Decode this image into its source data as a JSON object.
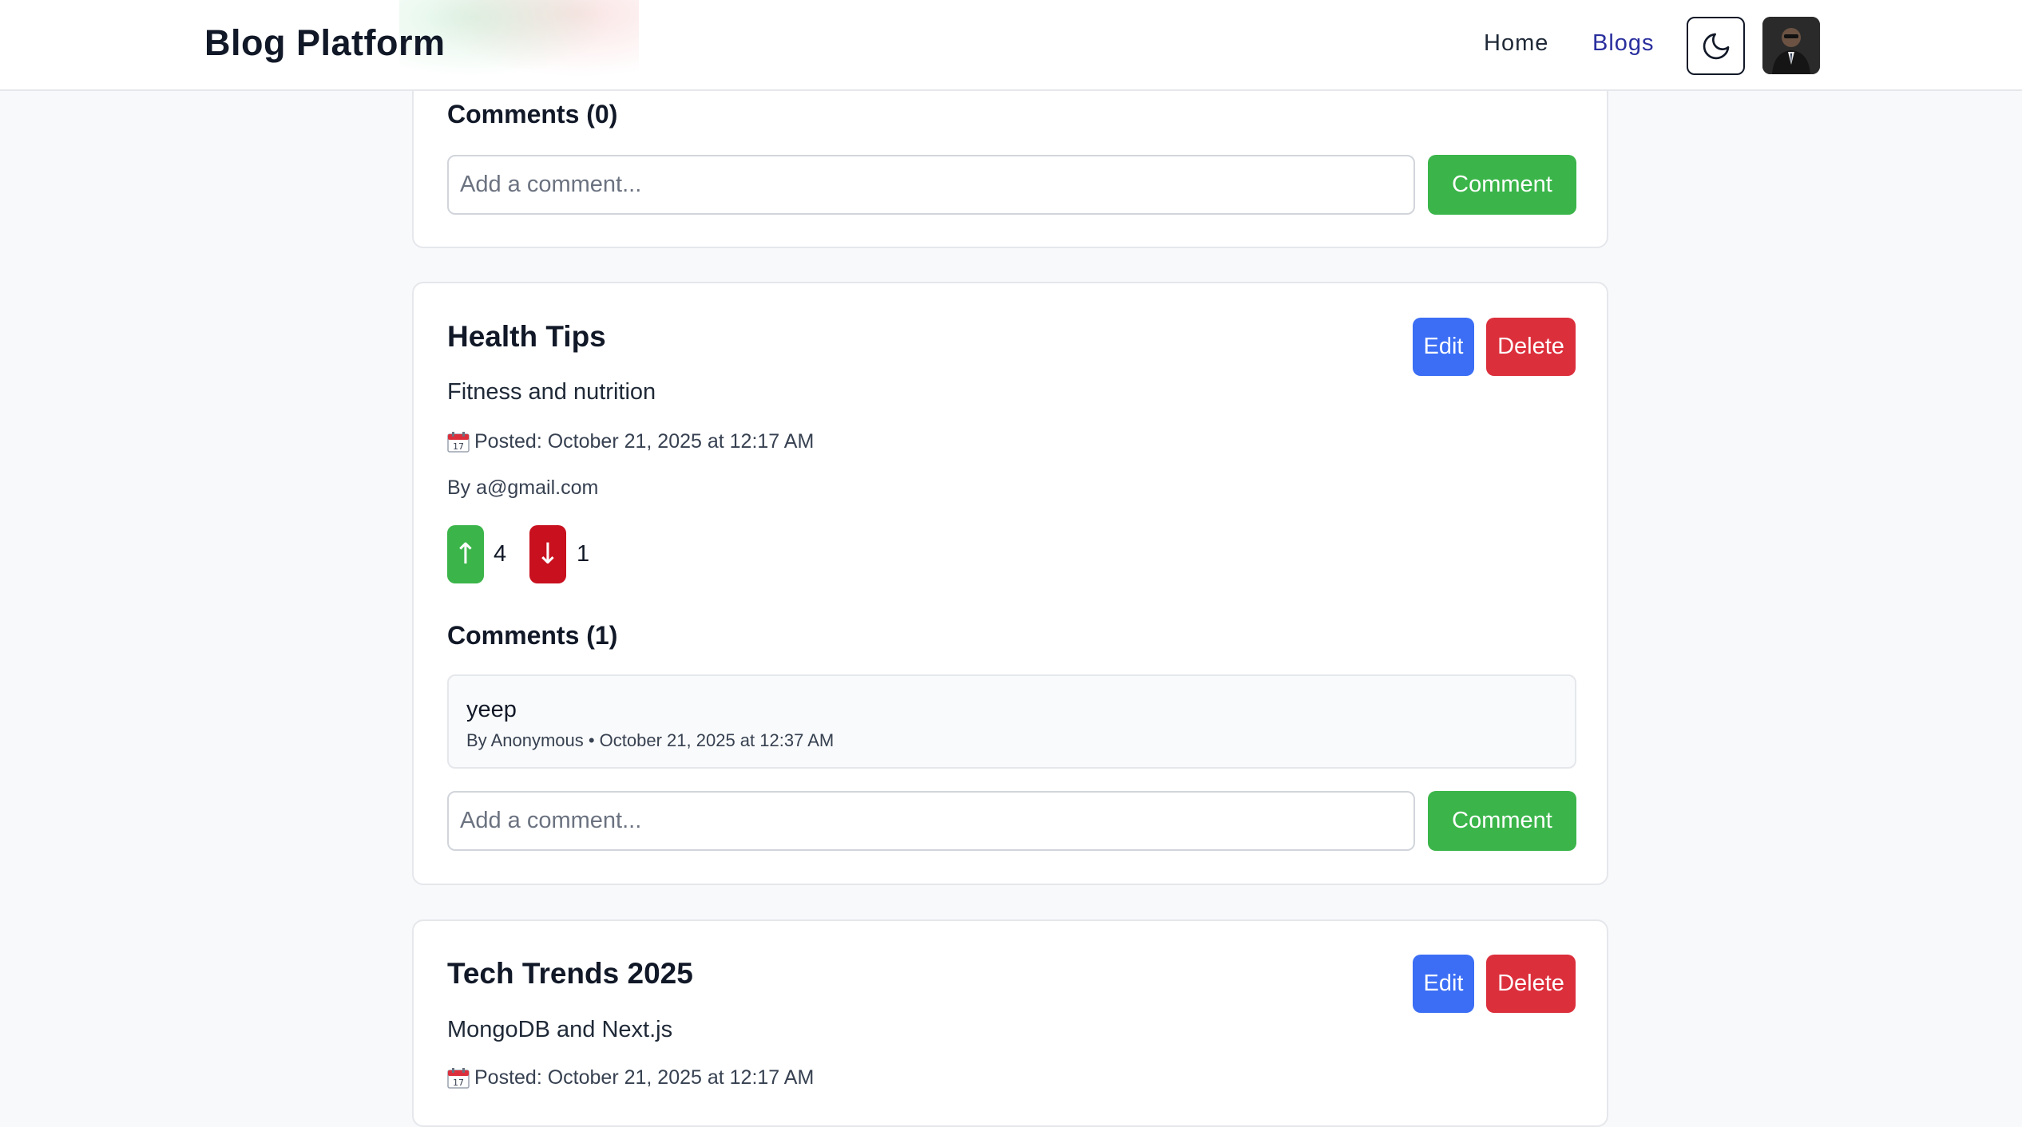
{
  "header": {
    "brand": "Blog Platform",
    "nav": {
      "home": "Home",
      "blogs": "Blogs"
    },
    "theme_icon": "moon-icon",
    "avatar_alt": "user avatar"
  },
  "posts": [
    {
      "comments_heading": "Comments (0)",
      "comment_placeholder": "Add a comment...",
      "comment_button": "Comment"
    },
    {
      "title": "Health Tips",
      "description": "Fitness and nutrition",
      "posted": "Posted: October 21, 2025 at 12:17 AM",
      "author": "By a@gmail.com",
      "edit_label": "Edit",
      "delete_label": "Delete",
      "upvote_icon": "↑",
      "downvote_icon": "↓",
      "upvotes": "4",
      "downvotes": "1",
      "comments_heading": "Comments (1)",
      "comments": [
        {
          "text": "yeep",
          "meta": "By Anonymous • October 21, 2025 at 12:37 AM"
        }
      ],
      "comment_placeholder": "Add a comment...",
      "comment_button": "Comment"
    },
    {
      "title": "Tech Trends 2025",
      "description": "MongoDB and Next.js",
      "posted": "Posted: October 21, 2025 at 12:17 AM",
      "edit_label": "Edit",
      "delete_label": "Delete"
    }
  ],
  "colors": {
    "comment_button": "#3bb54a",
    "edit_button": "#3b6ef5",
    "delete_button": "#dc2f3c",
    "downvote_button": "#c8101e",
    "active_nav": "#2a2f9e"
  }
}
